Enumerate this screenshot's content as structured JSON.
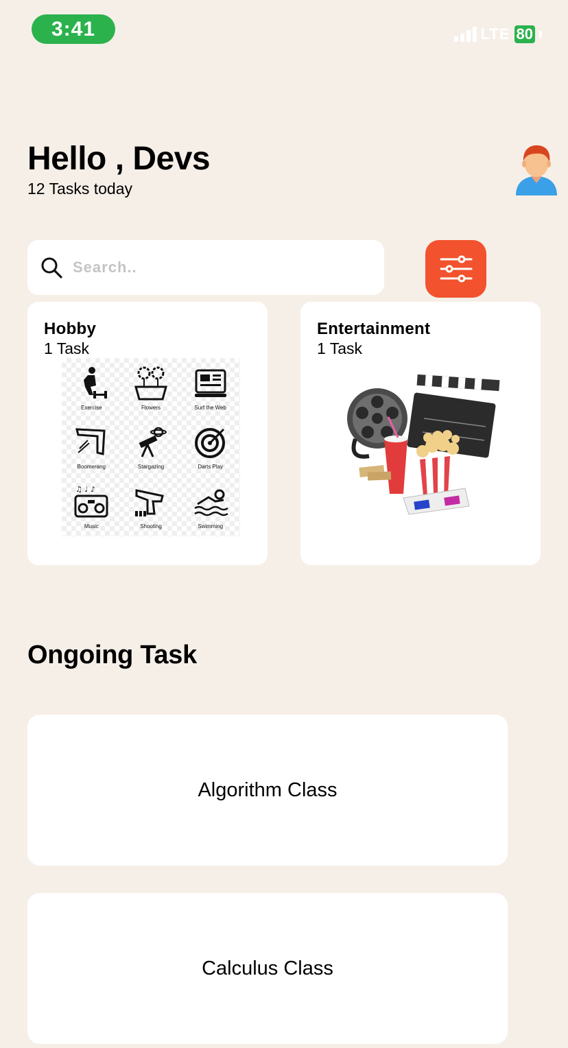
{
  "status_bar": {
    "time": "3:41",
    "network": "LTE",
    "battery": "80"
  },
  "header": {
    "greeting": "Hello , Devs",
    "subtitle": "12 Tasks today"
  },
  "search": {
    "placeholder": "Search.."
  },
  "categories": [
    {
      "title": "Hobby",
      "count": "1 Task",
      "items": [
        "Exercise",
        "Flowers",
        "Surf the Web",
        "Boomerang",
        "Stargazing",
        "Darts Play",
        "Music",
        "Shooting",
        "Swimming"
      ]
    },
    {
      "title": "Entertainment",
      "count": "1 Task"
    }
  ],
  "ongoing": {
    "title": "Ongoing Task",
    "tasks": [
      {
        "label": "Algorithm Class"
      },
      {
        "label": "Calculus Class"
      }
    ]
  },
  "colors": {
    "background": "#f6efe8",
    "accent": "#f2532e",
    "status_green": "#2bb24c"
  },
  "icons": {
    "avatar": "person-avatar-icon",
    "search": "search-icon",
    "filter": "sliders-icon"
  }
}
